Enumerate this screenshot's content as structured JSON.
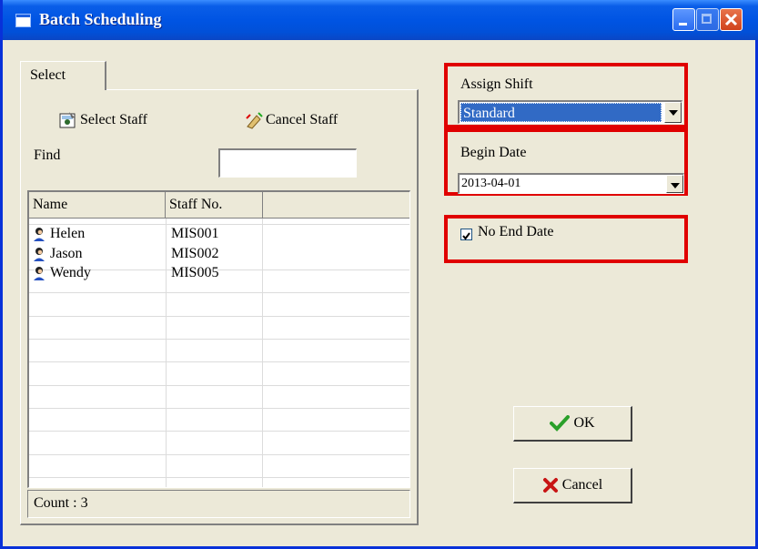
{
  "window": {
    "title": "Batch Scheduling"
  },
  "tabs": [
    {
      "label": "Select"
    }
  ],
  "toolbar": {
    "select_staff": "Select Staff",
    "cancel_staff": "Cancel Staff"
  },
  "find": {
    "label": "Find",
    "value": ""
  },
  "grid": {
    "columns": [
      "Name",
      "Staff No."
    ],
    "rows": [
      {
        "name": "Helen",
        "staff_no": "MIS001"
      },
      {
        "name": "Jason",
        "staff_no": "MIS002"
      },
      {
        "name": "Wendy",
        "staff_no": "MIS005"
      }
    ]
  },
  "count_label": "Count : 3",
  "assign_shift": {
    "label": "Assign Shift",
    "value": "Standard"
  },
  "begin_date": {
    "label": "Begin Date",
    "value": "2013-04-01"
  },
  "no_end_date": {
    "label": "No End Date",
    "checked": true
  },
  "buttons": {
    "ok": "OK",
    "cancel": "Cancel"
  },
  "colors": {
    "highlight_border": "#e00000",
    "title_bar": "#0054e3",
    "selection": "#316ac5"
  }
}
